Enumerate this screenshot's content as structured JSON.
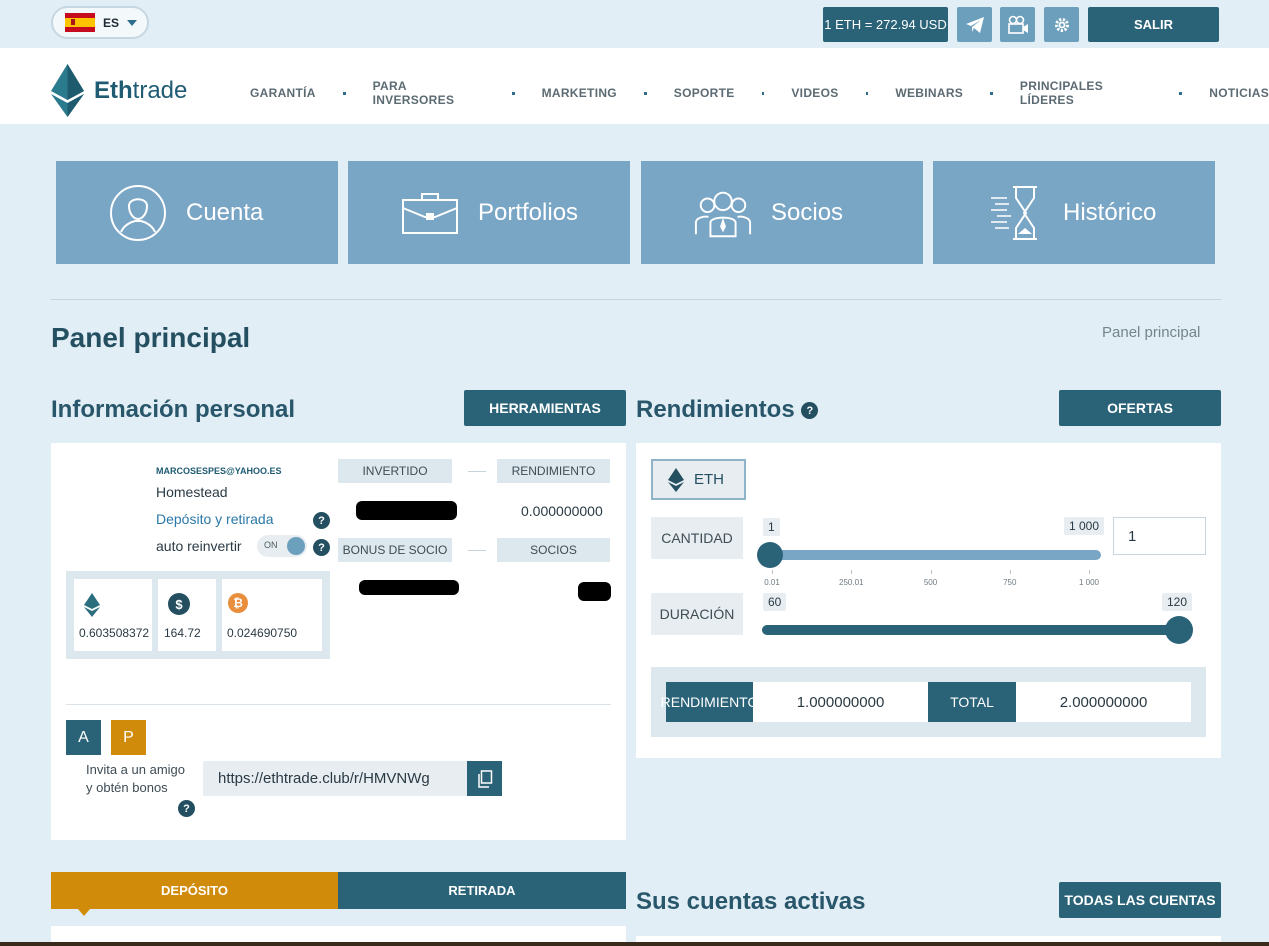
{
  "topbar": {
    "lang_code": "ES",
    "rate": "1 ETH = 272.94 USD",
    "logout": "SALIR"
  },
  "brand": {
    "name_bold": "Eth",
    "name_rest": "trade"
  },
  "nav": [
    "GARANTÍA",
    "PARA INVERSORES",
    "MARKETING",
    "SOPORTE",
    "VIDEOS",
    "WEBINARS",
    "PRINCIPALES LÍDERES",
    "NOTICIAS"
  ],
  "tiles": [
    "Cuenta",
    "Portfolios",
    "Socios",
    "Histórico"
  ],
  "page": {
    "title": "Panel principal",
    "breadcrumb": "Panel principal"
  },
  "personal": {
    "title": "Información personal",
    "tools_button": "HERRAMIENTAS",
    "email": "MARCOSESPES@YAHOO.ES",
    "plan": "Homestead",
    "deposit_link": "Depósito y retirada",
    "auto_reinvest": "auto reinvertir",
    "toggle_state": "ON",
    "invested_label": "INVERTIDO",
    "yield_label": "RENDIMIENTO",
    "yield_value": "0.000000000",
    "bonus_label": "BONUS DE SOCIO",
    "partners_label": "SOCIOS",
    "wallets": {
      "eth": "0.603508372",
      "usd": "164.72",
      "btc": "0.024690750"
    },
    "btn_a": "A",
    "btn_p": "P",
    "invite_line1": "Invita a un amigo",
    "invite_line2": "y obtén bonos",
    "ref_link": "https://ethtrade.club/r/HMVNWg"
  },
  "returns": {
    "title": "Rendimientos",
    "offers_button": "OFERTAS",
    "currency": "ETH",
    "amount_label": "CANTIDAD",
    "amount_current": "1",
    "amount_max_label": "1 000",
    "amount_input": "1",
    "amount_fraction": 0.0,
    "amount_scale": [
      "0.01",
      "250.01",
      "500",
      "750",
      "1 000"
    ],
    "duration_label": "DURACIÓN",
    "duration_min": "60",
    "duration_current": "120",
    "duration_fraction": 1.0,
    "result_label": "RENDIMIENTO",
    "result_value": "1.000000000",
    "total_label": "TOTAL",
    "total_value": "2.000000000"
  },
  "tabs": {
    "deposit": "DEPÓSITO",
    "withdraw": "RETIRADA"
  },
  "active": {
    "title": "Sus cuentas activas",
    "all_button": "TODAS LAS CUENTAS"
  },
  "colors": {
    "primary": "#2a6378",
    "tile": "#7aa6c6",
    "accent": "#d18b0a",
    "background": "#e2eef5"
  }
}
